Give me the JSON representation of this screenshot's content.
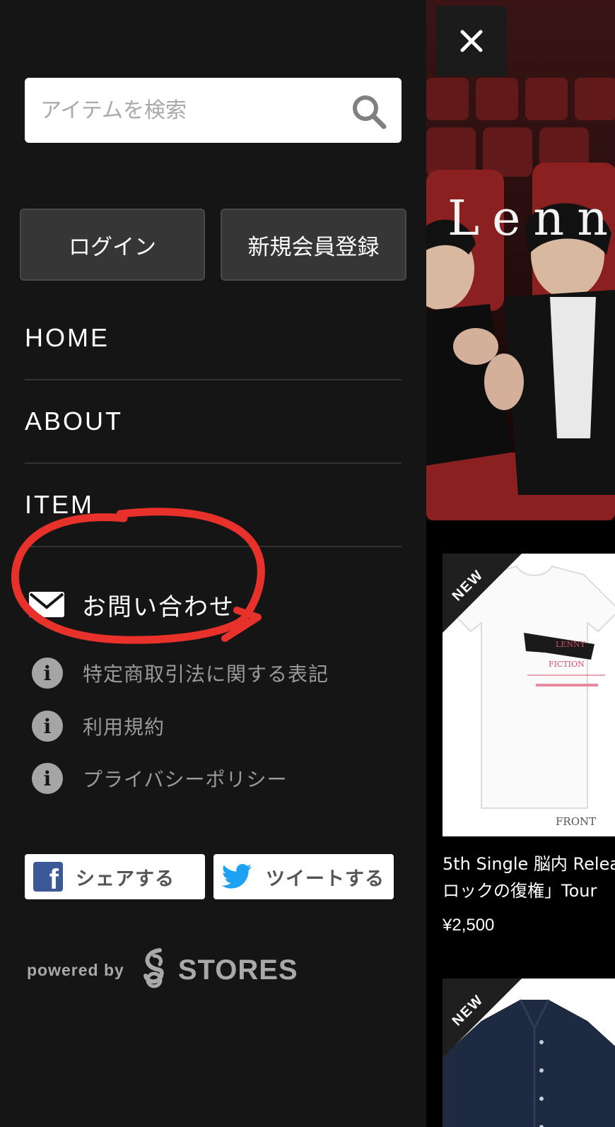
{
  "search": {
    "placeholder": "アイテムを検索"
  },
  "auth": {
    "login_label": "ログイン",
    "register_label": "新規会員登録"
  },
  "nav": [
    {
      "label": "HOME"
    },
    {
      "label": "ABOUT"
    },
    {
      "label": "ITEM"
    }
  ],
  "contact": {
    "label": "お問い合わせ",
    "icon": "mail-icon"
  },
  "info_links": [
    {
      "label": "特定商取引法に関する表記",
      "icon": "info-icon"
    },
    {
      "label": "利用規約",
      "icon": "info-icon"
    },
    {
      "label": "プライバシーポリシー",
      "icon": "info-icon"
    }
  ],
  "share": {
    "facebook_label": "シェアする",
    "twitter_label": "ツイートする"
  },
  "powered": {
    "prefix": "powered by",
    "brand": "STORES"
  },
  "hero": {
    "title": "Lenny"
  },
  "products": [
    {
      "badge": "NEW",
      "front_label": "FRONT",
      "name_line1": "5th Single 脳内 Relea",
      "name_line2": "ロックの復権」Tour",
      "price": "¥2,500"
    },
    {
      "badge": "NEW"
    }
  ],
  "colors": {
    "drawer_bg": "#151515",
    "annotation": "#e8312b",
    "facebook": "#3b5998",
    "twitter": "#1da1f2"
  }
}
